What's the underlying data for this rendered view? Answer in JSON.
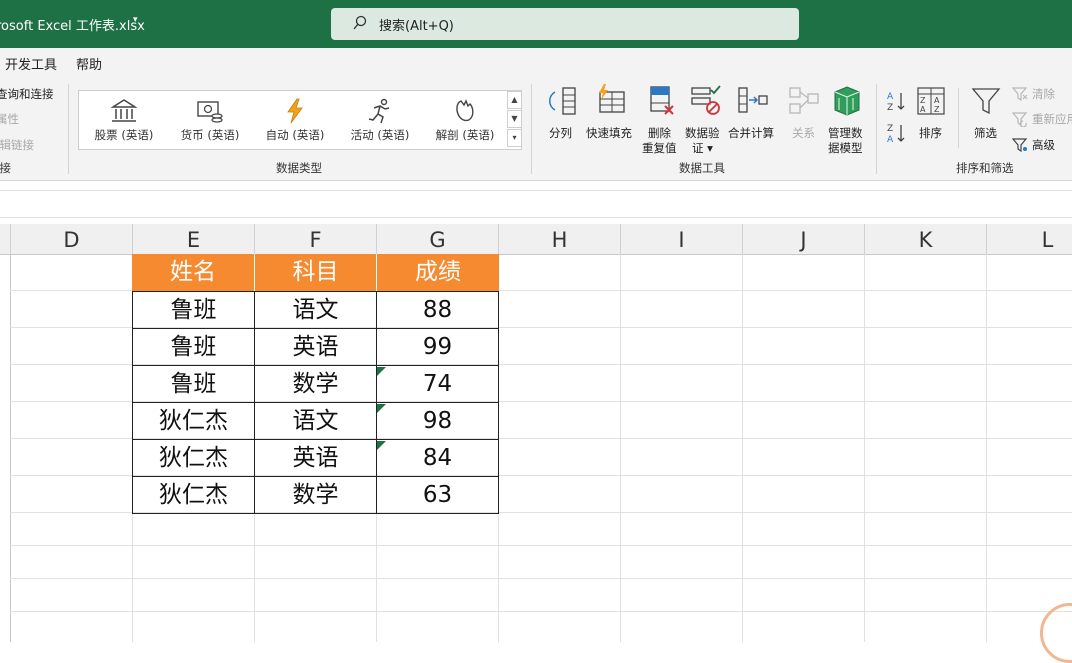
{
  "window": {
    "title": "rosoft Excel  工作表.xlsx",
    "caret": "▾"
  },
  "search": {
    "text": "搜索(Alt+Q)"
  },
  "menu": [
    "开发工具",
    "帮助"
  ],
  "ribbon": {
    "connections": {
      "items": [
        "查询和连接",
        "属性",
        "编辑链接"
      ],
      "group_label": "连接"
    },
    "data_types": {
      "items": [
        {
          "label": "股票 (英语)",
          "icon": "bank-icon"
        },
        {
          "label": "货币 (英语)",
          "icon": "currency-icon"
        },
        {
          "label": "自动 (英语)",
          "icon": "lightning-icon"
        },
        {
          "label": "活动 (英语)",
          "icon": "runner-icon"
        },
        {
          "label": "解剖 (英语)",
          "icon": "anatomy-icon"
        }
      ],
      "group_label": "数据类型"
    },
    "data_tools": {
      "split": "分列",
      "flash_fill": "快速填充",
      "remove_dup_1": "删除",
      "remove_dup_2": "重复值",
      "validation_1": "数据验",
      "validation_2": "证 ▾",
      "consolidate": "合并计算",
      "relationships": "关系",
      "manage_model_1": "管理数",
      "manage_model_2": "据模型",
      "group_label": "数据工具"
    },
    "sort_filter": {
      "sort": "排序",
      "filter": "筛选",
      "clear": "清除",
      "reapply": "重新应用",
      "advanced": "高级",
      "group_label": "排序和筛选"
    }
  },
  "columns": [
    "D",
    "E",
    "F",
    "G",
    "H",
    "I",
    "J",
    "K",
    "L"
  ],
  "table": {
    "headers": [
      "姓名",
      "科目",
      "成绩"
    ],
    "rows": [
      [
        "鲁班",
        "语文",
        "88"
      ],
      [
        "鲁班",
        "英语",
        "99"
      ],
      [
        "鲁班",
        "数学",
        "74"
      ],
      [
        "狄仁杰",
        "语文",
        "98"
      ],
      [
        "狄仁杰",
        "英语",
        "84"
      ],
      [
        "狄仁杰",
        "数学",
        "63"
      ]
    ],
    "header_color": "#f58a30"
  },
  "colors": {
    "title_bar": "#1e7145",
    "accent_orange": "#f58a30"
  }
}
